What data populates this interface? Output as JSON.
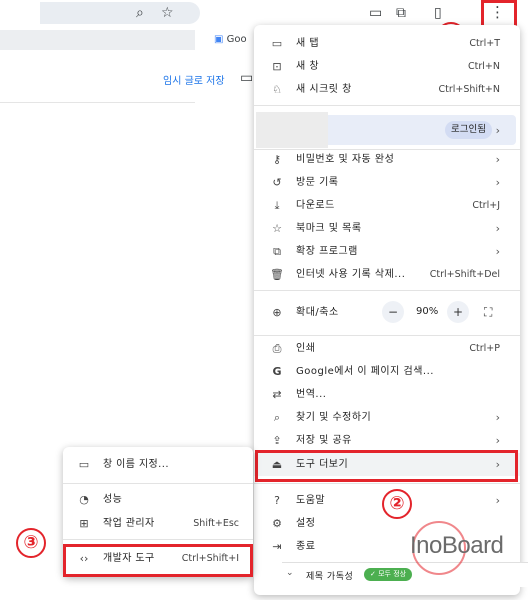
{
  "browser": {
    "bookmark_favicon_text": "Goo",
    "save_link": "임시 글로 저장"
  },
  "menu": {
    "new_tab": {
      "label": "새 탭",
      "shortcut": "Ctrl+T"
    },
    "new_window": {
      "label": "새 창",
      "shortcut": "Ctrl+N"
    },
    "new_incognito": {
      "label": "새 시크릿 창",
      "shortcut": "Ctrl+Shift+N"
    },
    "profile_login": "로그인됨",
    "passwords": {
      "label": "비밀번호 및 자동 완성"
    },
    "history": {
      "label": "방문 기록"
    },
    "downloads": {
      "label": "다운로드",
      "shortcut": "Ctrl+J"
    },
    "bookmarks": {
      "label": "북마크 및 목록"
    },
    "extensions": {
      "label": "확장 프로그램"
    },
    "clear_data": {
      "label": "인터넷 사용 기록 삭제...",
      "shortcut": "Ctrl+Shift+Del"
    },
    "zoom": {
      "label": "확대/축소",
      "minus": "−",
      "value": "90%",
      "plus": "+"
    },
    "print": {
      "label": "인쇄",
      "shortcut": "Ctrl+P"
    },
    "search_page": {
      "label": "Google에서 이 페이지 검색..."
    },
    "translate": {
      "label": "번역..."
    },
    "find_edit": {
      "label": "찾기 및 수정하기"
    },
    "save_share": {
      "label": "저장 및 공유"
    },
    "more_tools": {
      "label": "도구 더보기"
    },
    "help": {
      "label": "도움말"
    },
    "settings": {
      "label": "설정"
    },
    "exit": {
      "label": "종료"
    }
  },
  "submenu": {
    "name_window": {
      "label": "창 이름 지정..."
    },
    "performance": {
      "label": "성능"
    },
    "task_manager": {
      "label": "작업 관리자",
      "shortcut": "Shift+Esc"
    },
    "devtools": {
      "label": "개발자 도구",
      "shortcut": "Ctrl+Shift+I"
    }
  },
  "annotations": {
    "step1": "①",
    "step2": "②",
    "step3": "③",
    "highlight_color": "#e3242b"
  },
  "bottom": {
    "title_label": "제목 가독성",
    "status": "✓ 모두 정상"
  },
  "watermark": "InoBoard"
}
